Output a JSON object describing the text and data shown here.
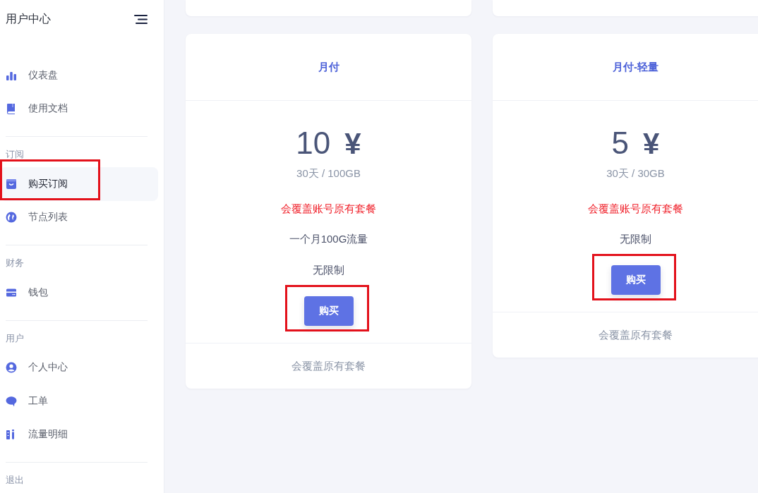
{
  "sidebar": {
    "title": "用户中心",
    "groups": [
      {
        "items": [
          {
            "label": "仪表盘",
            "selected": false,
            "annotated": false
          },
          {
            "label": "使用文档",
            "selected": false,
            "annotated": false
          }
        ]
      },
      {
        "heading": "订阅",
        "items": [
          {
            "label": "购买订阅",
            "selected": true,
            "annotated": true
          },
          {
            "label": "节点列表",
            "selected": false,
            "annotated": false
          }
        ]
      },
      {
        "heading": "财务",
        "items": [
          {
            "label": "钱包",
            "selected": false,
            "annotated": false
          }
        ]
      },
      {
        "heading": "用户",
        "items": [
          {
            "label": "个人中心",
            "selected": false,
            "annotated": false
          },
          {
            "label": "工单",
            "selected": false,
            "annotated": false
          },
          {
            "label": "流量明细",
            "selected": false,
            "annotated": false
          }
        ]
      },
      {
        "heading": "退出"
      }
    ]
  },
  "plans": [
    {
      "title": "月付",
      "price": "10",
      "currency": "¥",
      "period": "30天 / 100GB",
      "notice": "会覆盖账号原有套餐",
      "features": [
        "一个月100G流量",
        "无限制"
      ],
      "button": {
        "label": "购买",
        "annotated": true
      },
      "footer": "会覆盖原有套餐"
    },
    {
      "title": "月付-轻量",
      "price": "5",
      "currency": "¥",
      "period": "30天 / 30GB",
      "notice": "会覆盖账号原有套餐",
      "features": [
        "无限制"
      ],
      "button": {
        "label": "购买",
        "annotated": true
      },
      "footer": "会覆盖原有套餐"
    }
  ]
}
